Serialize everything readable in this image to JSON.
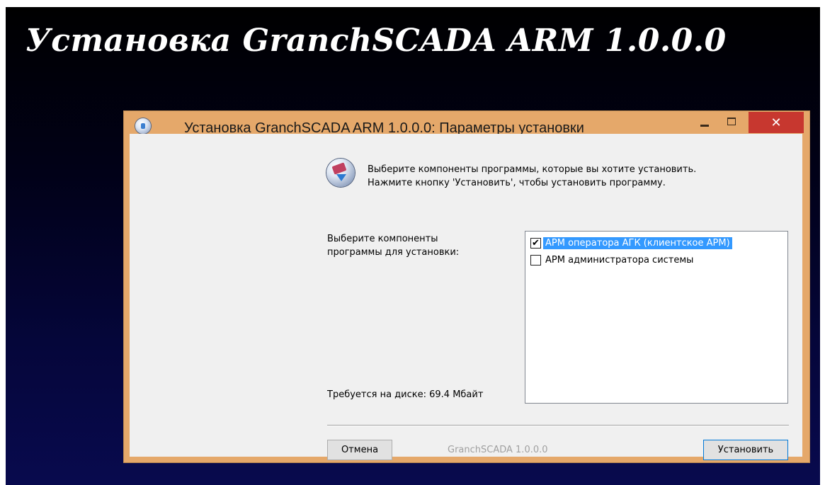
{
  "banner": {
    "title": "Установка GranchSCADA ARM 1.0.0.0"
  },
  "window": {
    "title": "Установка GranchSCADA ARM 1.0.0.0: Параметры установки",
    "close_glyph": "✕"
  },
  "header": {
    "line1": "Выберите компоненты программы, которые вы хотите установить.",
    "line2": "Нажмите кнопку 'Установить', чтобы установить программу."
  },
  "components": {
    "prompt_line1": "Выберите компоненты",
    "prompt_line2": "программы для установки:",
    "disk_required": "Требуется на диске: 69.4 Мбайт",
    "items": [
      {
        "label": "АРМ оператора АГК (клиентское АРМ)",
        "checked": true,
        "selected": true
      },
      {
        "label": "АРМ администратора системы",
        "checked": false,
        "selected": false
      }
    ]
  },
  "footer": {
    "cancel_label": "Отмена",
    "brand": "GranchSCADA 1.0.0.0",
    "install_label": "Установить"
  },
  "icons": {
    "app": "installer-disc-icon",
    "header": "install-disc-arrow-icon",
    "check": "checkmark-icon"
  },
  "colors": {
    "frame": "#e5a86a",
    "close_button": "#c7372f",
    "selection": "#3399ff",
    "dialog_bg": "#f0f0f0"
  }
}
